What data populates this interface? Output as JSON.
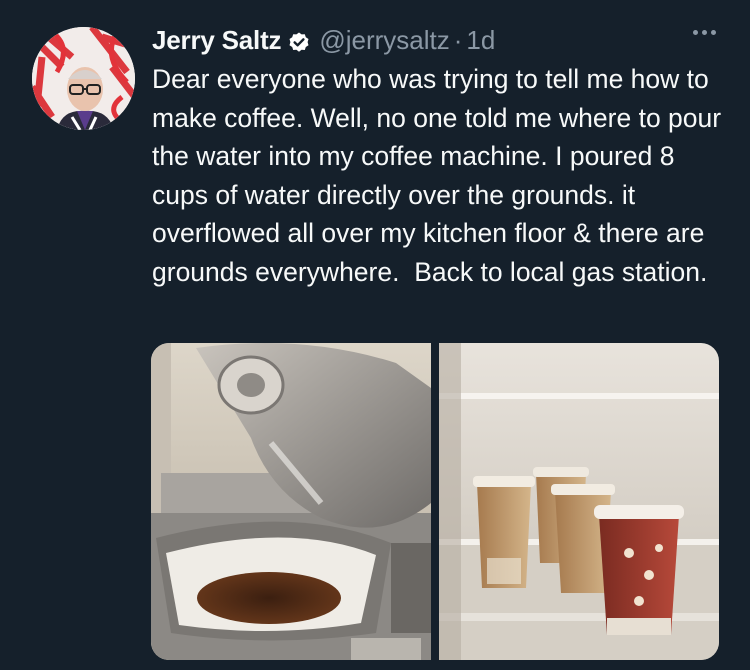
{
  "tweet": {
    "author_name": "Jerry Saltz",
    "handle": "@jerrysaltz",
    "separator": "·",
    "time": "1d",
    "text": "Dear everyone who was trying to tell me how to make coffee. Well, no one told me where to pour the water into my coffee machine. I poured 8 cups of water directly over the grounds. it overflowed all over my kitchen floor & there are grounds everywhere.  Back to local gas station."
  },
  "icons": {
    "verified": "verified-badge-icon",
    "more": "more-options-icon"
  },
  "colors": {
    "background": "#15202b",
    "text_primary": "#f7f9f9",
    "text_secondary": "#8b98a5",
    "verified": "#ffffff"
  }
}
